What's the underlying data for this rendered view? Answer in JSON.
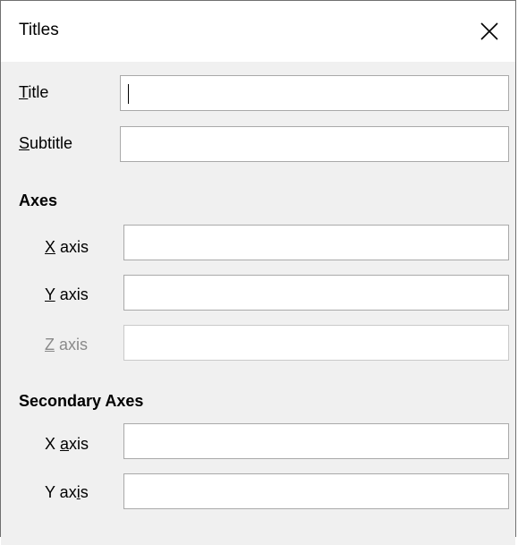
{
  "dialog": {
    "title": "Titles"
  },
  "fields": {
    "title": {
      "label_u": "T",
      "label_rest": "itle",
      "value": ""
    },
    "subtitle": {
      "label_u": "S",
      "label_rest": "ubtitle",
      "value": ""
    }
  },
  "axes": {
    "heading": "Axes",
    "x": {
      "label_u": "X",
      "label_rest": " axis",
      "value": ""
    },
    "y": {
      "label_u": "Y",
      "label_rest": " axis",
      "value": ""
    },
    "z": {
      "label_u": "Z",
      "label_rest": " axis",
      "value": "",
      "disabled": true
    }
  },
  "secondary_axes": {
    "heading": "Secondary Axes",
    "x": {
      "label_pre": "X ",
      "label_u": "a",
      "label_rest": "xis",
      "value": ""
    },
    "y": {
      "label_pre": "Y ax",
      "label_u": "i",
      "label_rest": "s",
      "value": ""
    }
  },
  "icons": {
    "close": "close-icon"
  }
}
